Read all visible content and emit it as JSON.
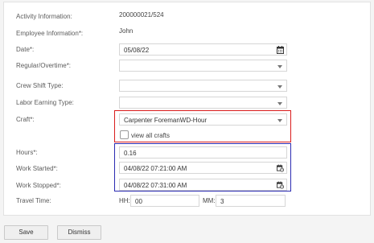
{
  "form": {
    "activity_info": {
      "label": "Activity Information:",
      "value": "200000021/524"
    },
    "employee_info": {
      "label": "Employee Information*:",
      "value": "John"
    },
    "date": {
      "label": "Date*:",
      "value": "05/08/22",
      "icon": "calendar-icon"
    },
    "regular_overtime": {
      "label": "Regular/Overtime*:",
      "value": ""
    },
    "crew_shift_type": {
      "label": "Crew Shift Type:",
      "value": ""
    },
    "labor_earning_type": {
      "label": "Labor Earning Type:",
      "value": ""
    },
    "craft": {
      "label": "Craft*:",
      "value": "Carpenter ForemanWD-Hour",
      "view_all_label": "view all crafts"
    },
    "hours": {
      "label": "Hours*:",
      "value": "0.16"
    },
    "work_started": {
      "label": "Work Started*:",
      "value": "04/08/22 07:21:00 AM",
      "icon": "calendar-clock-icon"
    },
    "work_stopped": {
      "label": "Work Stopped*:",
      "value": "04/08/22 07:31:00 AM",
      "icon": "calendar-clock-icon"
    },
    "travel_time": {
      "label": "Travel Time:",
      "hh_label": "HH:",
      "hh_value": "00",
      "mm_label": "MM:",
      "mm_value": "3"
    }
  },
  "buttons": {
    "save": "Save",
    "dismiss": "Dismiss"
  },
  "colors": {
    "highlight_red": "#d91c1c",
    "highlight_blue": "#2b2bb2"
  }
}
